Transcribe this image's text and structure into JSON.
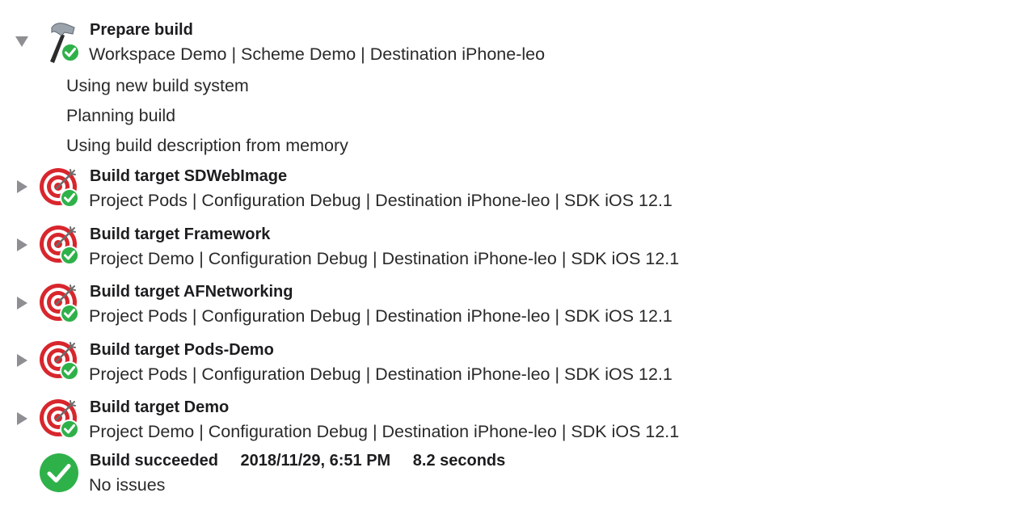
{
  "prepare": {
    "title": "Prepare build",
    "subtitle": "Workspace Demo | Scheme Demo | Destination iPhone-leo",
    "icon": "hammer-icon",
    "expanded": true,
    "messages": [
      "Using new build system",
      "Planning build",
      "Using build description from memory"
    ]
  },
  "targets": [
    {
      "title": "Build target SDWebImage",
      "subtitle": "Project Pods | Configuration Debug | Destination iPhone-leo | SDK iOS 12.1",
      "icon": "target-icon",
      "status": "success"
    },
    {
      "title": "Build target Framework",
      "subtitle": "Project Demo | Configuration Debug | Destination iPhone-leo | SDK iOS 12.1",
      "icon": "target-icon",
      "status": "success"
    },
    {
      "title": "Build target AFNetworking",
      "subtitle": "Project Pods | Configuration Debug | Destination iPhone-leo | SDK iOS 12.1",
      "icon": "target-icon",
      "status": "success"
    },
    {
      "title": "Build target Pods-Demo",
      "subtitle": "Project Pods | Configuration Debug | Destination iPhone-leo | SDK iOS 12.1",
      "icon": "target-icon",
      "status": "success"
    },
    {
      "title": "Build target Demo",
      "subtitle": "Project Demo | Configuration Debug | Destination iPhone-leo | SDK iOS 12.1",
      "icon": "target-icon",
      "status": "success"
    }
  ],
  "result": {
    "status": "Build succeeded",
    "timestamp": "2018/11/29, 6:51 PM",
    "duration": "8.2 seconds",
    "issues": "No issues",
    "icon": "checkmark-circle-icon"
  },
  "colors": {
    "success_green": "#2fb14a",
    "target_red": "#d8262d",
    "disclosure_gray": "#8e8e93"
  }
}
